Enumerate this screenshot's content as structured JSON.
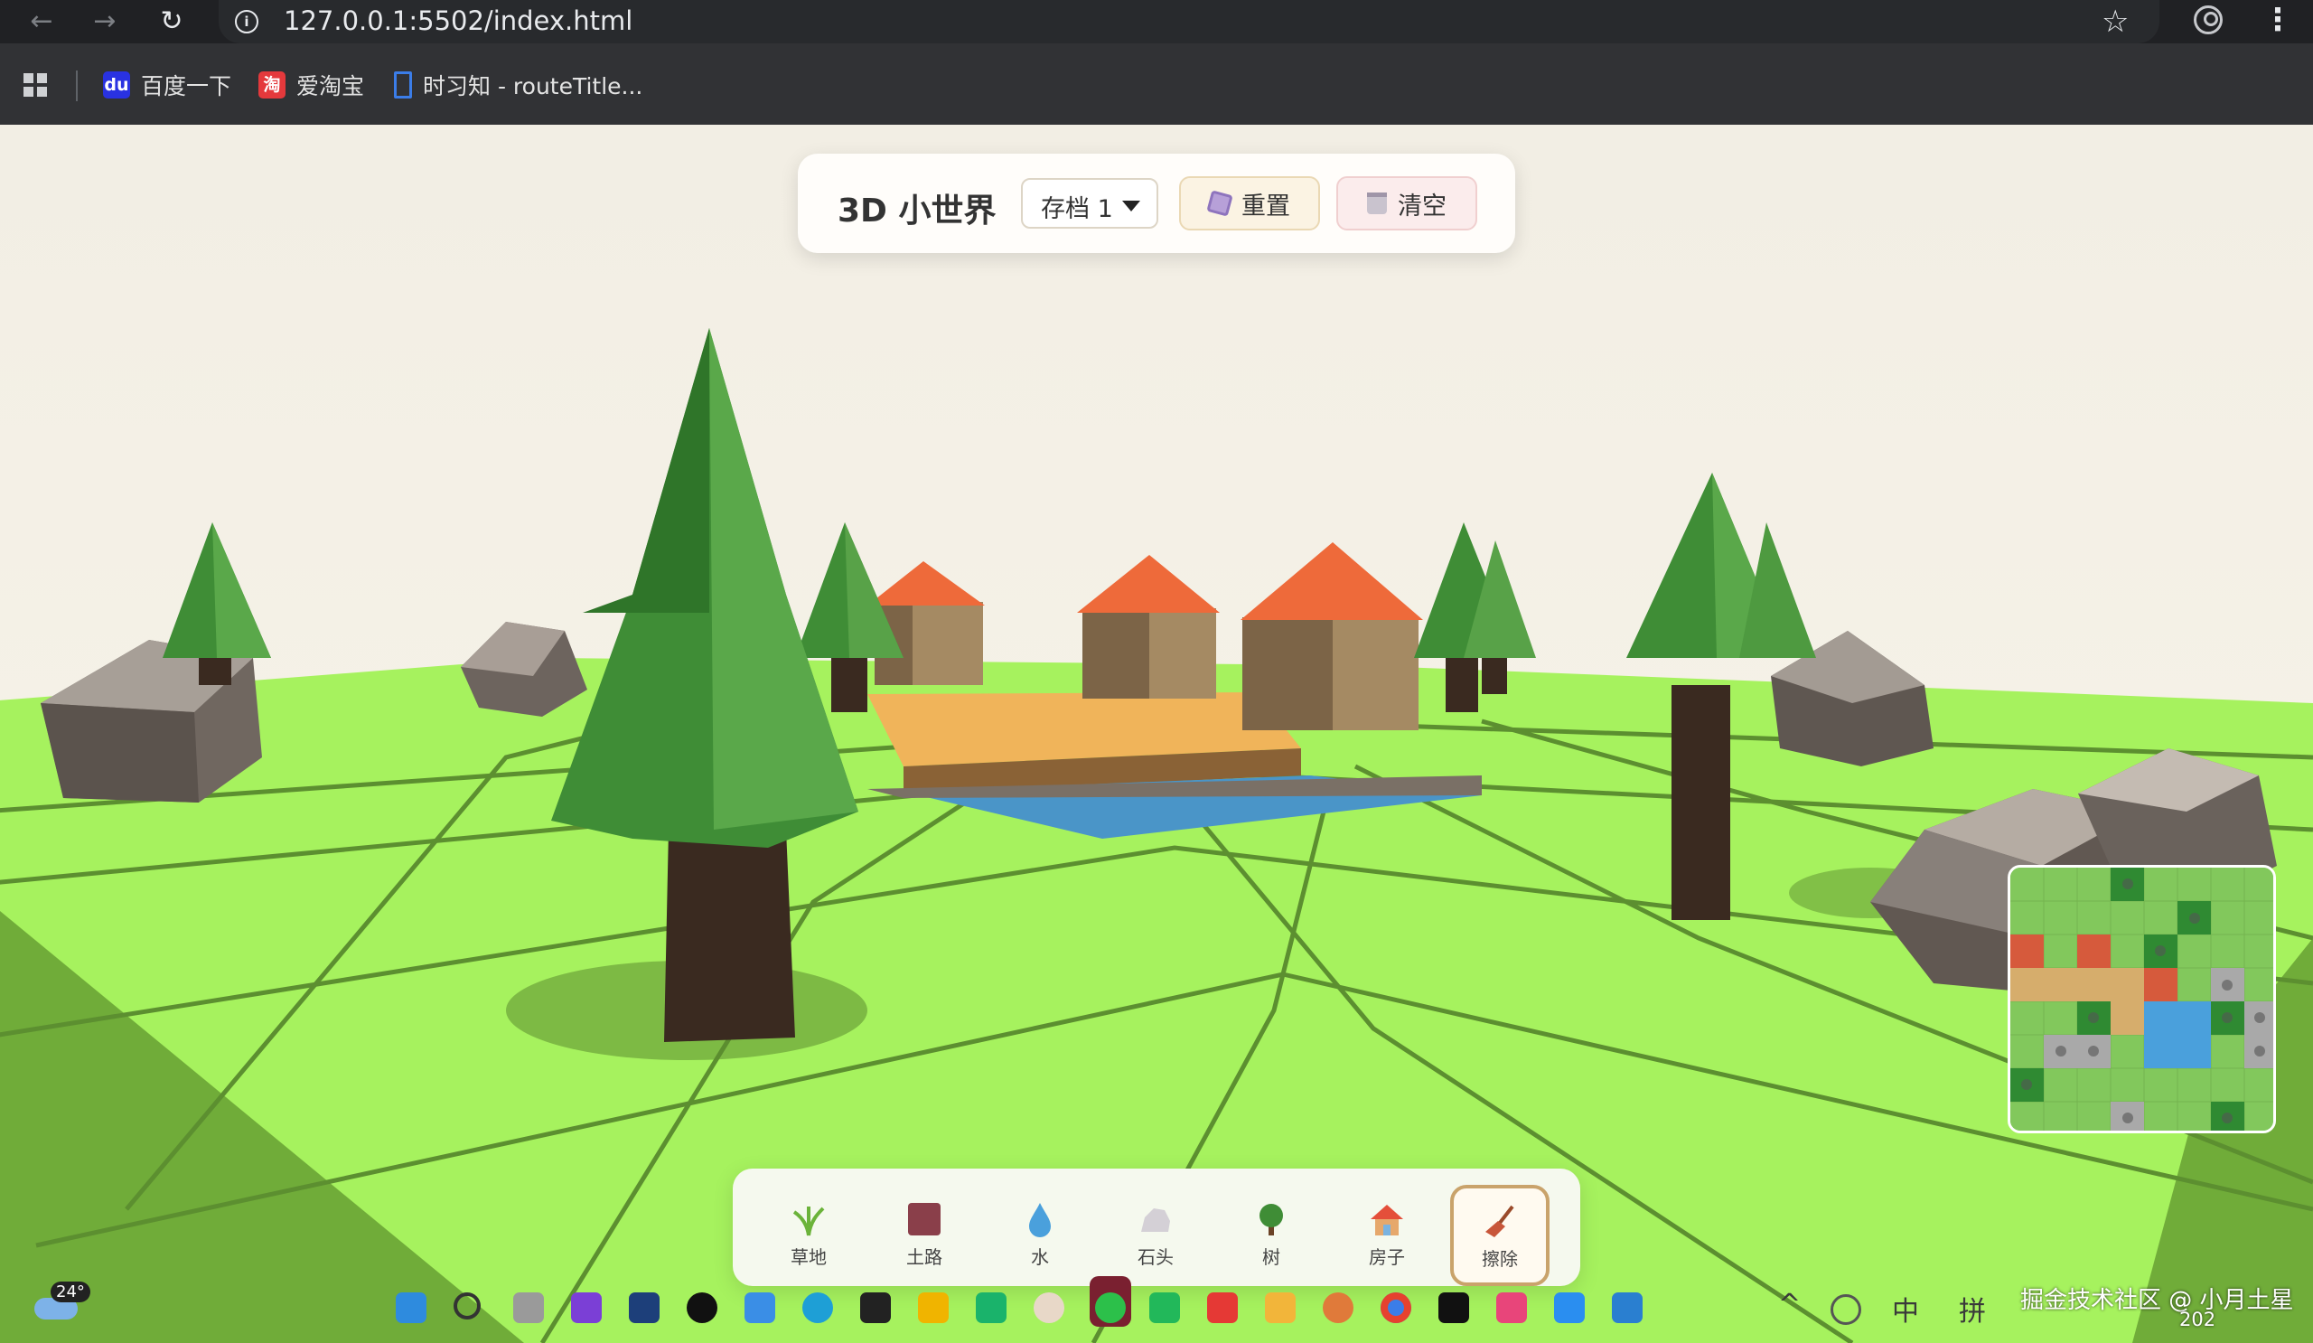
{
  "browser": {
    "url": "127.0.0.1:5502/index.html",
    "bookmarks": [
      {
        "label": "百度一下",
        "icon": "baidu-icon",
        "color": "#2932e1"
      },
      {
        "label": "爱淘宝",
        "icon": "taobao-icon",
        "color": "#e4393c"
      },
      {
        "label": "时习知 - routeTitle...",
        "icon": "bookmark-icon",
        "color": "#3b7de8"
      }
    ]
  },
  "app": {
    "title": "3D 小世界",
    "save_slot": "存档 1",
    "reset_label": "重置",
    "clear_label": "清空"
  },
  "toolbar": {
    "tools": [
      {
        "id": "grass",
        "label": "草地",
        "icon": "grass-icon"
      },
      {
        "id": "dirt",
        "label": "土路",
        "icon": "dirt-icon"
      },
      {
        "id": "water",
        "label": "水",
        "icon": "water-drop-icon"
      },
      {
        "id": "rock",
        "label": "石头",
        "icon": "rock-icon"
      },
      {
        "id": "tree",
        "label": "树",
        "icon": "tree-icon"
      },
      {
        "id": "house",
        "label": "房子",
        "icon": "house-icon"
      },
      {
        "id": "erase",
        "label": "擦除",
        "icon": "broom-icon"
      }
    ],
    "active_tool": "erase"
  },
  "taskbar": {
    "weather_temp": "24°",
    "ime_lang": "中",
    "ime_mode": "拼"
  },
  "watermark": {
    "text": "掘金技术社区 @ 小月土星",
    "sub": "202"
  },
  "colors": {
    "grass": "#a6f25e",
    "grass_side": "#6aa435",
    "water": "#4a95c8",
    "dirt": "#f0b45a",
    "roof": "#ee6a3a",
    "tree": "#3f8d36",
    "rock": "#8e857e"
  }
}
